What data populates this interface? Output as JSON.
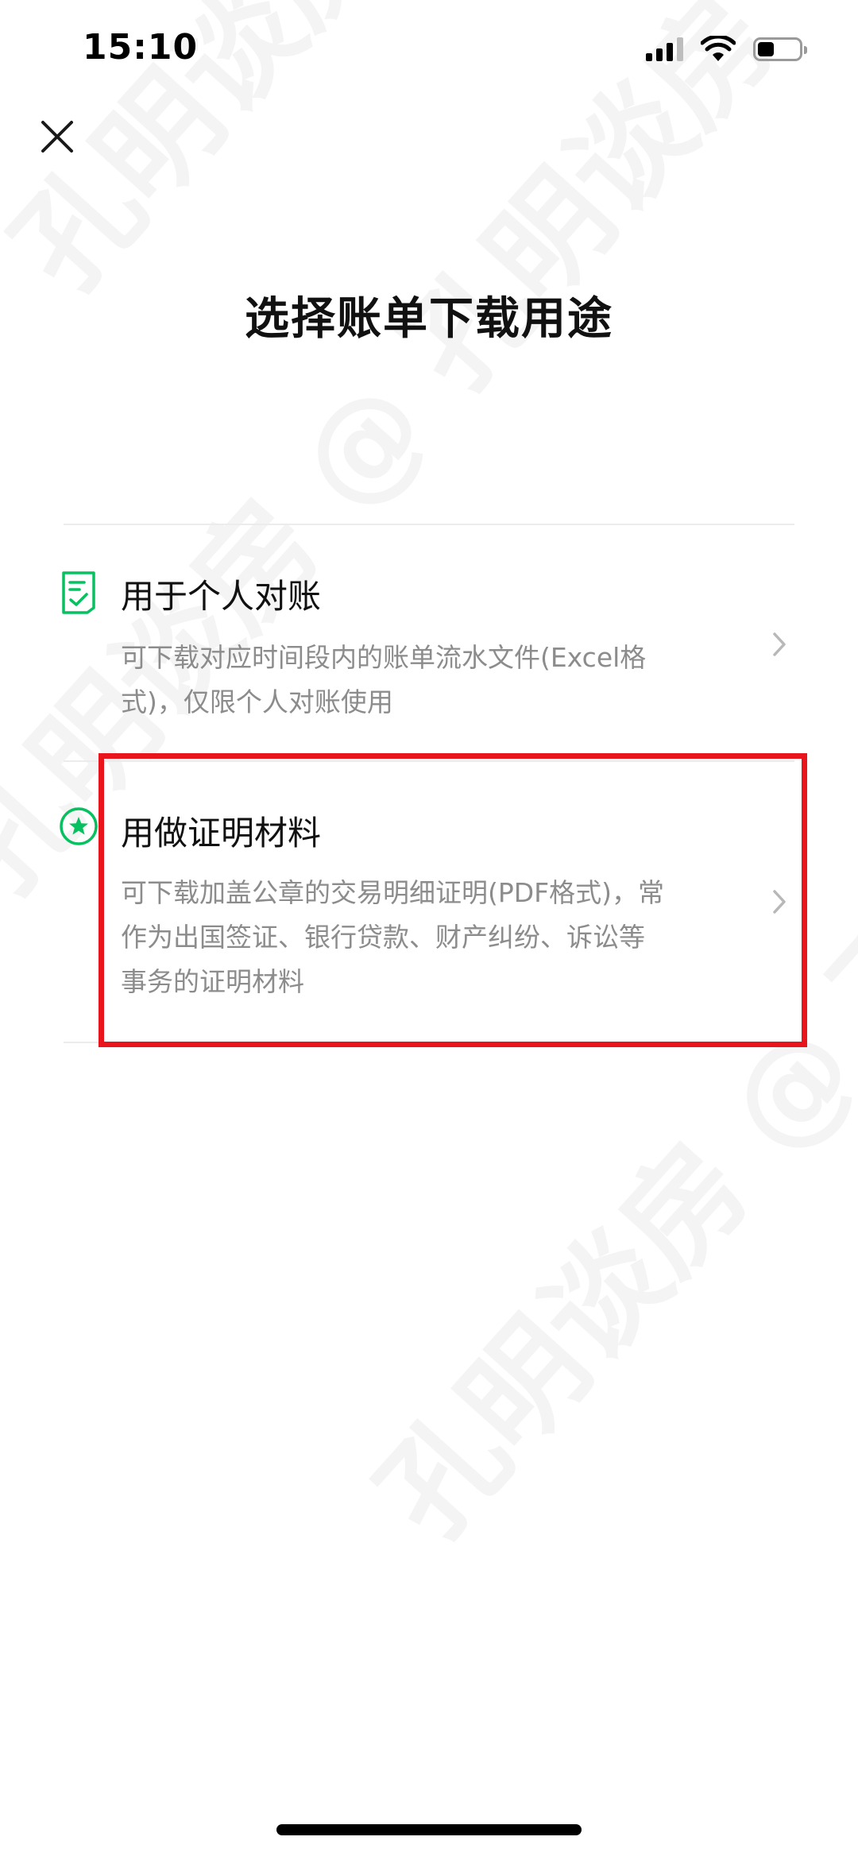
{
  "status_bar": {
    "time": "15:10"
  },
  "header": {
    "title": "选择账单下载用途"
  },
  "options": [
    {
      "title": "用于个人对账",
      "desc_lines": [
        "可下载对应时间段内的账单流水文件(Excel格",
        "式)，仅限个人对账使用"
      ]
    },
    {
      "title": "用做证明材料",
      "desc_lines": [
        "可下载加盖公章的交易明细证明(PDF格式)，常",
        "作为出国签证、银行贷款、财产纠纷、诉讼等",
        "事务的证明材料"
      ]
    }
  ],
  "watermark_text": "孔明谈房 @ 孔明谈房",
  "colors": {
    "accent": "#07c160",
    "highlight": "#e8161c",
    "muted_text": "#8c8c8c"
  },
  "icons": {
    "close": "close-icon",
    "option_1": "document-check-icon",
    "option_2": "star-badge-icon",
    "chevron": "chevron-right-icon"
  }
}
